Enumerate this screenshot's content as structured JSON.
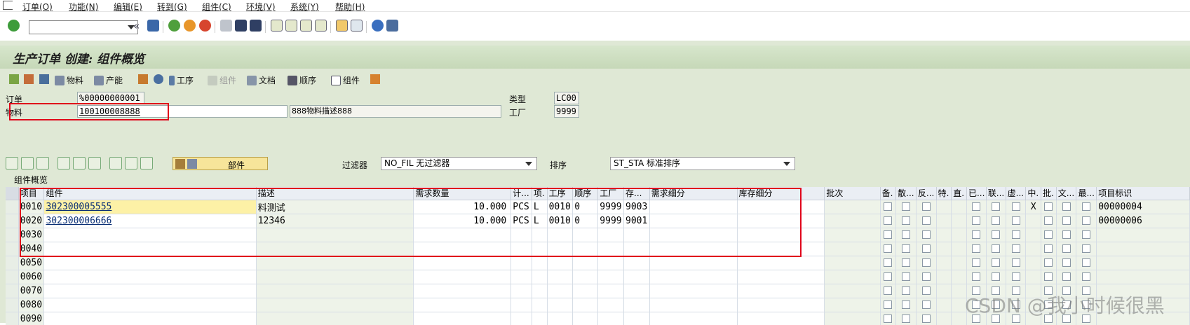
{
  "menu": [
    "订单(O)",
    "功能(N)",
    "编辑(E)",
    "转到(G)",
    "组件(C)",
    "环境(V)",
    "系统(Y)",
    "帮助(H)"
  ],
  "page_title": "生产订单 创建: 组件概览",
  "app_toolbar": {
    "material": "物料",
    "capacity": "产能",
    "operation": "工序",
    "component_disabled": "组件",
    "document": "文档",
    "sequence": "顺序",
    "component": "组件"
  },
  "header": {
    "order_label": "订单",
    "order_value": "%00000000001",
    "material_label": "物料",
    "material_value": "100100008888",
    "material_desc": "888物料描述888",
    "type_label": "类型",
    "type_value": "LC00",
    "plant_label": "工厂",
    "plant_value": "9999"
  },
  "controls": {
    "parts_button": "部件",
    "filter_label": "过滤器",
    "filter_value": "NO_FIL 无过滤器",
    "sort_label": "排序",
    "sort_value": "ST_STA 标准排序"
  },
  "grid": {
    "title": "组件概览",
    "columns": [
      "项目",
      "组件",
      "描述",
      "需求数量",
      "计...",
      "项.",
      "工序",
      "顺序",
      "工厂",
      "存...",
      "需求细分",
      "库存细分",
      "批次",
      "备.",
      "散...",
      "反...",
      "特.",
      "直.",
      "已...",
      "联...",
      "虚...",
      "中.",
      "批.",
      "文...",
      "最...",
      "项目标识"
    ],
    "rows": [
      {
        "item": "0010",
        "component": "302300005555",
        "desc": "料测试",
        "qty": "10.000",
        "unit": "PCS",
        "cat": "L",
        "op": "0010",
        "seq": "0",
        "plant": "9999",
        "sloc": "9003",
        "mid": "X",
        "itemid": "00000004"
      },
      {
        "item": "0020",
        "component": "302300006666",
        "desc": "12346",
        "qty": "10.000",
        "unit": "PCS",
        "cat": "L",
        "op": "0010",
        "seq": "0",
        "plant": "9999",
        "sloc": "9001",
        "mid": "",
        "itemid": "00000006"
      },
      {
        "item": "0030"
      },
      {
        "item": "0040"
      },
      {
        "item": "0050"
      },
      {
        "item": "0060"
      },
      {
        "item": "0070"
      },
      {
        "item": "0080"
      },
      {
        "item": "0090"
      }
    ]
  },
  "watermark": "CSDN @我小时候很黑"
}
